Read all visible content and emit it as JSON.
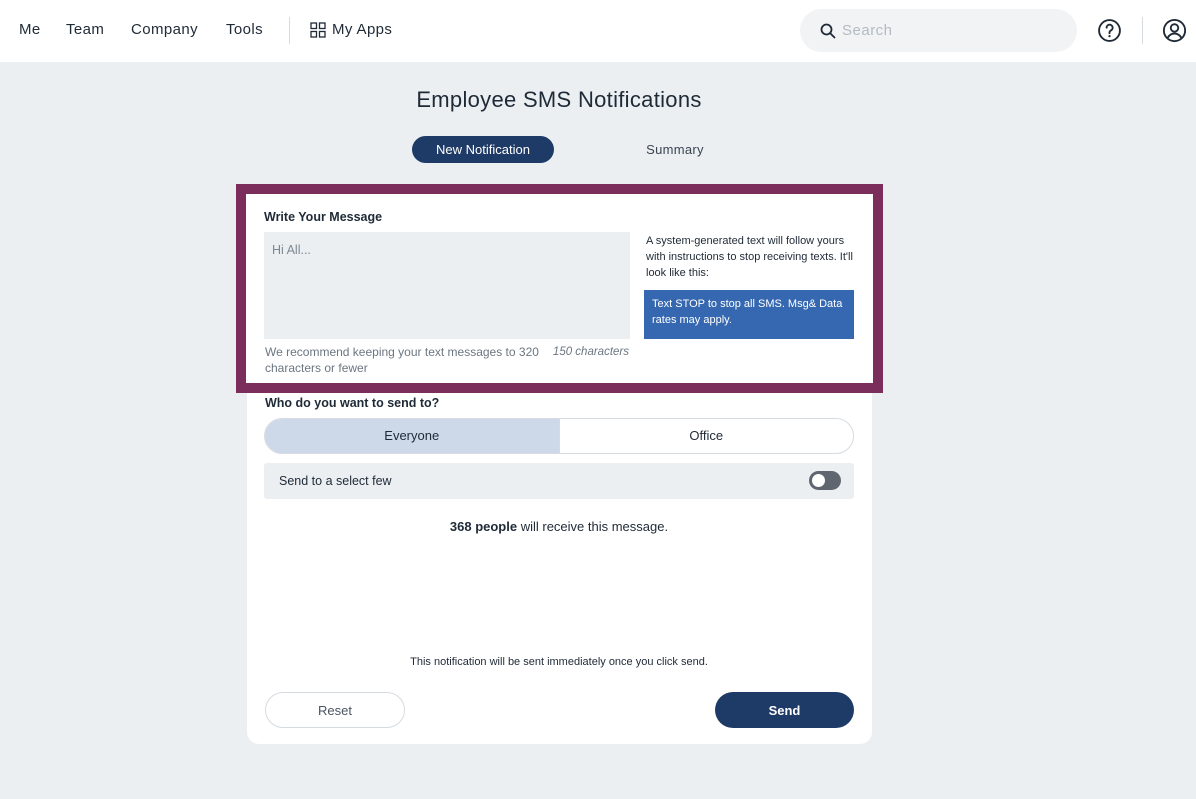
{
  "nav": {
    "items": [
      "Me",
      "Team",
      "Company",
      "Tools"
    ],
    "my_apps": "My Apps",
    "apps_icon": "grid-icon",
    "search_placeholder": "Search",
    "help_icon": "help-circle-icon",
    "account_icon": "user-circle-icon"
  },
  "page": {
    "title": "Employee SMS Notifications",
    "tabs": [
      {
        "label": "New Notification",
        "active": true
      },
      {
        "label": "Summary",
        "active": false
      }
    ]
  },
  "message": {
    "label": "Write Your Message",
    "placeholder": "Hi All...",
    "hint": "We recommend keeping your text messages to 320 characters or fewer",
    "char_count": "150 characters",
    "system_note": "A system-generated text will follow yours with instructions to stop receiving texts. It'll look like this:",
    "preview_text": "Text STOP to stop all SMS. Msg& Data rates may apply."
  },
  "recipients": {
    "label": "Who do you want to send to?",
    "options": [
      {
        "label": "Everyone",
        "selected": true
      },
      {
        "label": "Office",
        "selected": false
      }
    ],
    "select_few_label": "Send to a select few",
    "select_few_enabled": false,
    "count": "368 people",
    "count_suffix": " will receive this message."
  },
  "footer": {
    "note": "This notification will be sent immediately once you click send.",
    "reset_label": "Reset",
    "send_label": "Send"
  },
  "colors": {
    "primary": "#1e3a66",
    "highlight_border": "#7b2e5b",
    "preview_bg": "#3568b0",
    "page_bg": "#ebeff2"
  }
}
